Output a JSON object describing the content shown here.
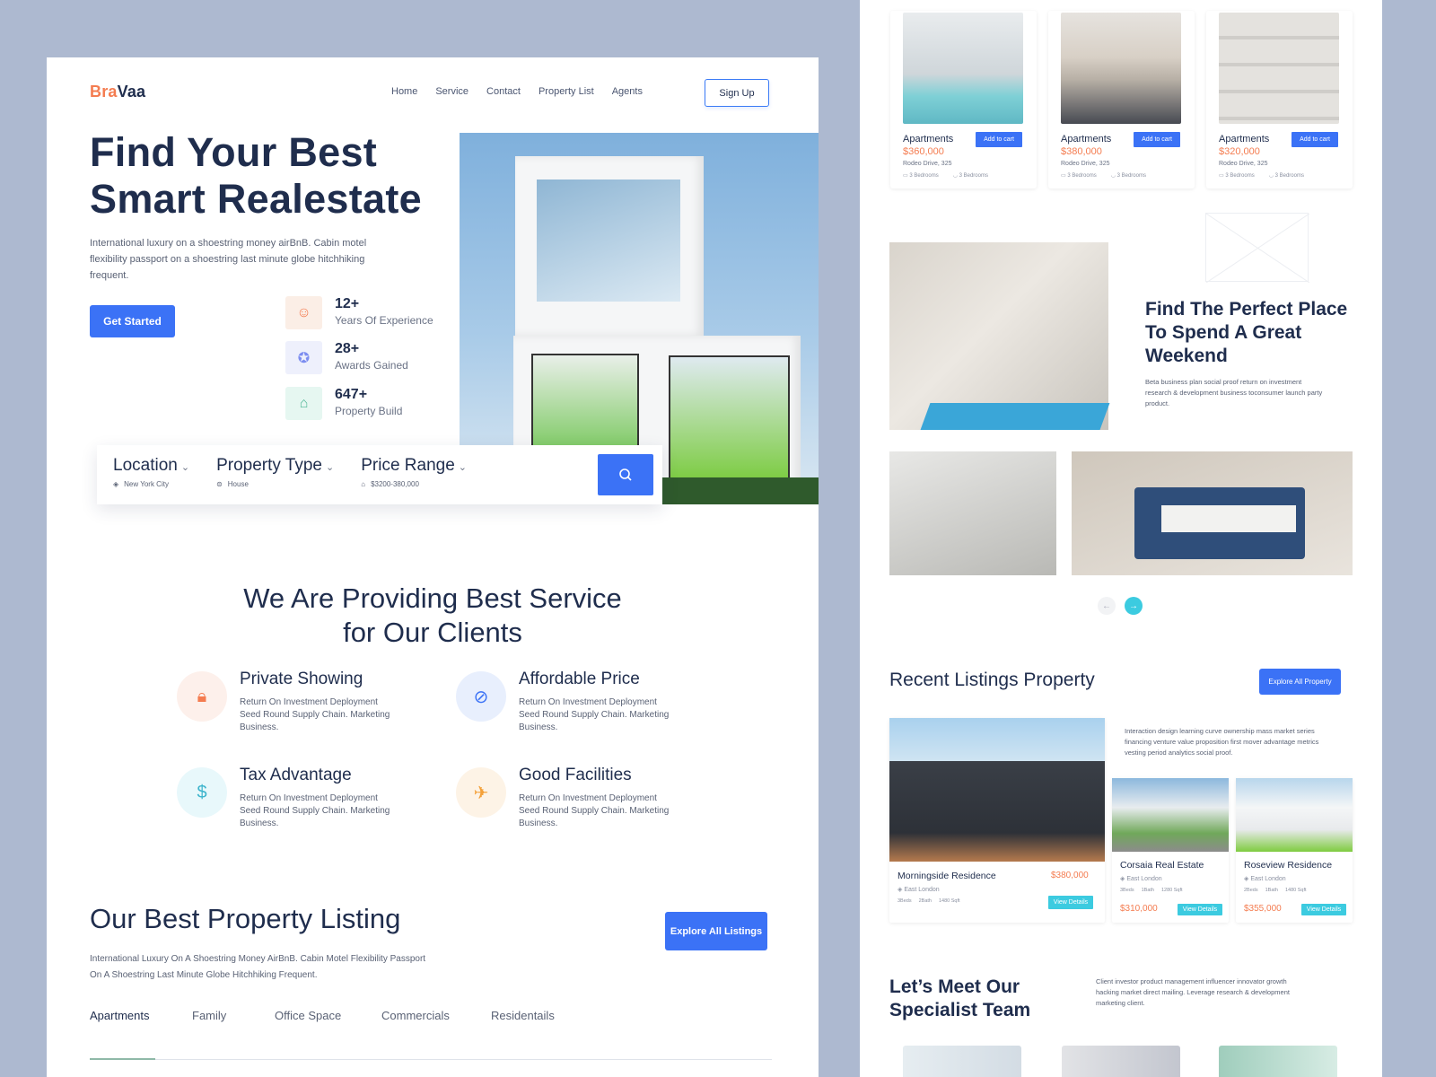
{
  "brand": {
    "part1": "Bra",
    "part2": "Vaa",
    "accent": "#f47c50",
    "primary": "#3b72f6",
    "teal": "#3ccbe0",
    "navy": "#1f2d4d"
  },
  "nav": {
    "items": [
      "Home",
      "Service",
      "Contact",
      "Property List",
      "Agents"
    ],
    "signup": "Sign Up"
  },
  "hero": {
    "title_line1": "Find Your Best",
    "title_line2": "Smart Realestate",
    "description": "International luxury on a shoestring money airBnB. Cabin motel flexibility passport on a shoestring last minute globe hitchhiking frequent.",
    "cta": "Get Started",
    "stats": [
      {
        "value": "12+",
        "label": "Years Of Experience",
        "icon": "brain-head-icon"
      },
      {
        "value": "28+",
        "label": "Awards Gained",
        "icon": "award-ribbon-icon"
      },
      {
        "value": "647+",
        "label": "Property Build",
        "icon": "house-heart-icon"
      }
    ]
  },
  "search": {
    "fields": [
      {
        "label": "Location",
        "value": "New York City",
        "icon": "location-icon"
      },
      {
        "label": "Property Type",
        "value": "House",
        "icon": "house-type-icon"
      },
      {
        "label": "Price Range",
        "value": "$3200-380,000",
        "icon": "price-tag-icon"
      }
    ],
    "button_icon": "search-icon"
  },
  "services": {
    "title_line1": "We Are Providing Best Service",
    "title_line2": "for Our Clients",
    "items": [
      {
        "title": "Private Showing",
        "desc": "Return On Investment Deployment Seed Round Supply Chain. Marketing Business.",
        "icon": "lock-icon"
      },
      {
        "title": "Affordable Price",
        "desc": "Return On Investment Deployment Seed Round Supply Chain. Marketing Business.",
        "icon": "price-tag-icon"
      },
      {
        "title": "Tax Advantage",
        "desc": "Return On Investment Deployment Seed Round Supply Chain. Marketing Business.",
        "icon": "money-bag-icon"
      },
      {
        "title": "Good Facilities",
        "desc": "Return On Investment Deployment Seed Round Supply Chain. Marketing Business.",
        "icon": "airplane-icon"
      }
    ]
  },
  "listing": {
    "title": "Our Best Property Listing",
    "desc_line1": "International Luxury On A Shoestring Money AirBnB. Cabin Motel Flexibility Passport",
    "desc_line2": "On A Shoestring Last Minute Globe Hitchhiking Frequent.",
    "explore": "Explore All Listings",
    "tabs": [
      "Apartments",
      "Family",
      "Office Space",
      "Commercials",
      "Residentails"
    ],
    "active_tab": "Apartments"
  },
  "apartments": [
    {
      "type": "Apartments",
      "price": "$360,000",
      "address": "Rodeo Drive, 325",
      "beds": "3 Bedrooms",
      "baths": "3 Bedrooms",
      "cart": "Add to cart"
    },
    {
      "type": "Apartments",
      "price": "$380,000",
      "address": "Rodeo Drive, 325",
      "beds": "3 Bedrooms",
      "baths": "3 Bedrooms",
      "cart": "Add to cart"
    },
    {
      "type": "Apartments",
      "price": "$320,000",
      "address": "Rodeo Drive, 325",
      "beds": "3 Bedrooms",
      "baths": "3 Bedrooms",
      "cart": "Add to cart"
    }
  ],
  "weekend": {
    "title": "Find The Perfect Place To Spend A Great Weekend",
    "desc": "Beta business plan social proof return on investment research & development business toconsumer launch party product."
  },
  "carousel": {
    "prev": "←",
    "next": "→"
  },
  "recent": {
    "title": "Recent Listings Property",
    "explore": "Explore All Property",
    "desc": "Interaction design learning curve ownership mass market series financing venture value proposition first mover advantage metrics vesting period analytics social proof.",
    "cards": [
      {
        "name": "Morningside Residence",
        "price": "$380,000",
        "location": "East London",
        "beds": "3Beds",
        "baths": "2Bath",
        "area": "1480 Sqft",
        "button": "View Details"
      },
      {
        "name": "Corsaia Real Estate",
        "price": "$310,000",
        "location": "East London",
        "beds": "3Beds",
        "baths": "1Bath",
        "area": "1280 Sqft",
        "button": "View Details"
      },
      {
        "name": "Roseview Residence",
        "price": "$355,000",
        "location": "East London",
        "beds": "2Beds",
        "baths": "1Bath",
        "area": "1480 Sqft",
        "button": "View Details"
      }
    ]
  },
  "team": {
    "title_line1": "Let’s Meet Our",
    "title_line2": "Specialist Team",
    "desc": "Client investor product management influencer innovator growth hacking market direct mailing. Leverage research & development marketing client."
  }
}
